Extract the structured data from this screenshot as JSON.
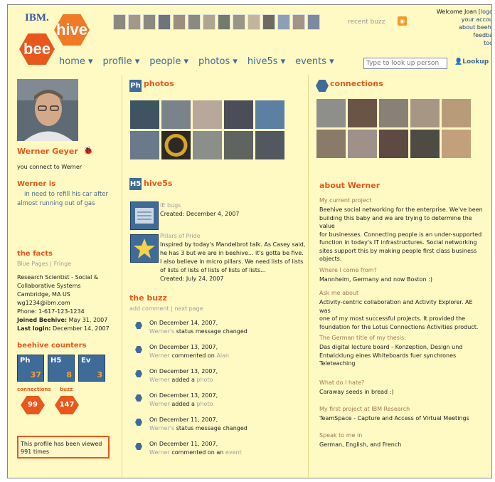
{
  "brand": {
    "company": "IBM.",
    "word1": "hive",
    "word2": "bee"
  },
  "header": {
    "recent_buzz": "recent buzz",
    "welcome": "Welcome Joan",
    "logout": "[logo",
    "links": [
      "your accou",
      "about beehi",
      "feedba",
      "too"
    ],
    "search_placeholder": "Type to look up person",
    "lookup_label": "Lookup",
    "nav": [
      "home ▾",
      "profile ▾",
      "people ▾",
      "photos ▾",
      "hive5s ▾",
      "events ▾"
    ]
  },
  "profile": {
    "name": "Werner Geyer",
    "connect_text": "you connect to Werner",
    "status_title": "Werner is",
    "status_text_1": "in need to refill his car after",
    "status_text_2": "almost running out of gas",
    "facts_title": "the facts",
    "facts_links": "Blue Pages | Fringe",
    "title_line1": "Research Scientist - Social &",
    "title_line2": "Collaborative Systems",
    "location": "Cambridge, MA US",
    "email": "wg1234@ibm.com",
    "phone": "Phone: 1-617-123-1234",
    "joined_label": "Joined Beehive:",
    "joined_value": "May 31, 2007",
    "last_login_label": "Last login:",
    "last_login_value": "December 14, 2007",
    "counters_title": "beehive counters",
    "counters": [
      {
        "label": "Ph",
        "value": "37"
      },
      {
        "label": "H5",
        "value": "8"
      },
      {
        "label": "Ev",
        "value": "3"
      }
    ],
    "connections_label": "connections",
    "connections_value": "99",
    "buzz_label": "buzz",
    "buzz_value": "147",
    "viewed_line1": "This profile has been viewed",
    "viewed_line2": "991 times"
  },
  "photos": {
    "badge": "Ph",
    "title": "photos"
  },
  "hive5s": {
    "badge": "H5",
    "title": "hive5s",
    "items": [
      {
        "title": "IE bugs",
        "created": "Created: December 4, 2007"
      },
      {
        "title": "Pillars of Pride",
        "body": [
          "Inspired by today's Mandelbrot talk. As Casey said,",
          "he has 3 but we are in beehive... it's gotta be five.",
          "I also believe in micro pillars. We need lists of lists",
          "of lists of lists of lists of lists of lists..."
        ],
        "created": "Created: July 24, 2007"
      }
    ]
  },
  "buzz": {
    "title": "the buzz",
    "actions": "add comment | next page",
    "items": [
      {
        "date": "On December 14, 2007,",
        "who": "Werner's",
        "rest": "status message changed",
        "obj": ""
      },
      {
        "date": "On December 13, 2007,",
        "who": "Werner",
        "rest": "commented on",
        "obj": "Alan"
      },
      {
        "date": "On December 13, 2007,",
        "who": "Werner",
        "rest": "added a",
        "obj": "photo"
      },
      {
        "date": "On December 13, 2007,",
        "who": "Werner",
        "rest": "added a",
        "obj": "photo"
      },
      {
        "date": "On December 11, 2007,",
        "who": "Werner's",
        "rest": "status message changed",
        "obj": ""
      },
      {
        "date": "On December 11, 2007,",
        "who": "Werner",
        "rest": "commented on an",
        "obj": "event"
      }
    ]
  },
  "connections": {
    "title": "connections"
  },
  "about": {
    "title": "about Werner",
    "items": [
      {
        "label": "My current project",
        "lines": [
          "Beehive social networking for the enterprise. We've been",
          "building this baby and we are trying to determine the value",
          "for businesses. Connecting people is an under-supported",
          "function in today's IT infrastructures. Social networking",
          "sites support this by making people first class business",
          "objects."
        ]
      },
      {
        "label": "Where I come from?",
        "lines": [
          "Mannheim, Germany and now Boston :)"
        ]
      },
      {
        "label": "Ask me about",
        "lines": [
          "Activity-centric collaboration and Activity Explorer. AE was",
          "one of my most successful projects. It provided the",
          "foundation for the Lotus Connections Activities product."
        ]
      },
      {
        "label": "The German title of my thesis:",
        "lines": [
          "Das digital lecture board - Konzeption, Design und",
          "Entwicklung eines Whiteboards fuer synchrones",
          "Teleteaching"
        ]
      },
      {
        "label": "What do I hate?",
        "lines": [
          "Caraway seeds in bread :)"
        ]
      },
      {
        "label": "My first project at IBM Research",
        "lines": [
          "TeamSpace - Capture and Access of Virtual Meetings"
        ]
      },
      {
        "label": "Speak to me in",
        "lines": [
          "German, English, and French"
        ]
      }
    ]
  },
  "colors": {
    "accent": "#e8581c",
    "nav": "#3f6b99",
    "background": "#fff9c4"
  }
}
